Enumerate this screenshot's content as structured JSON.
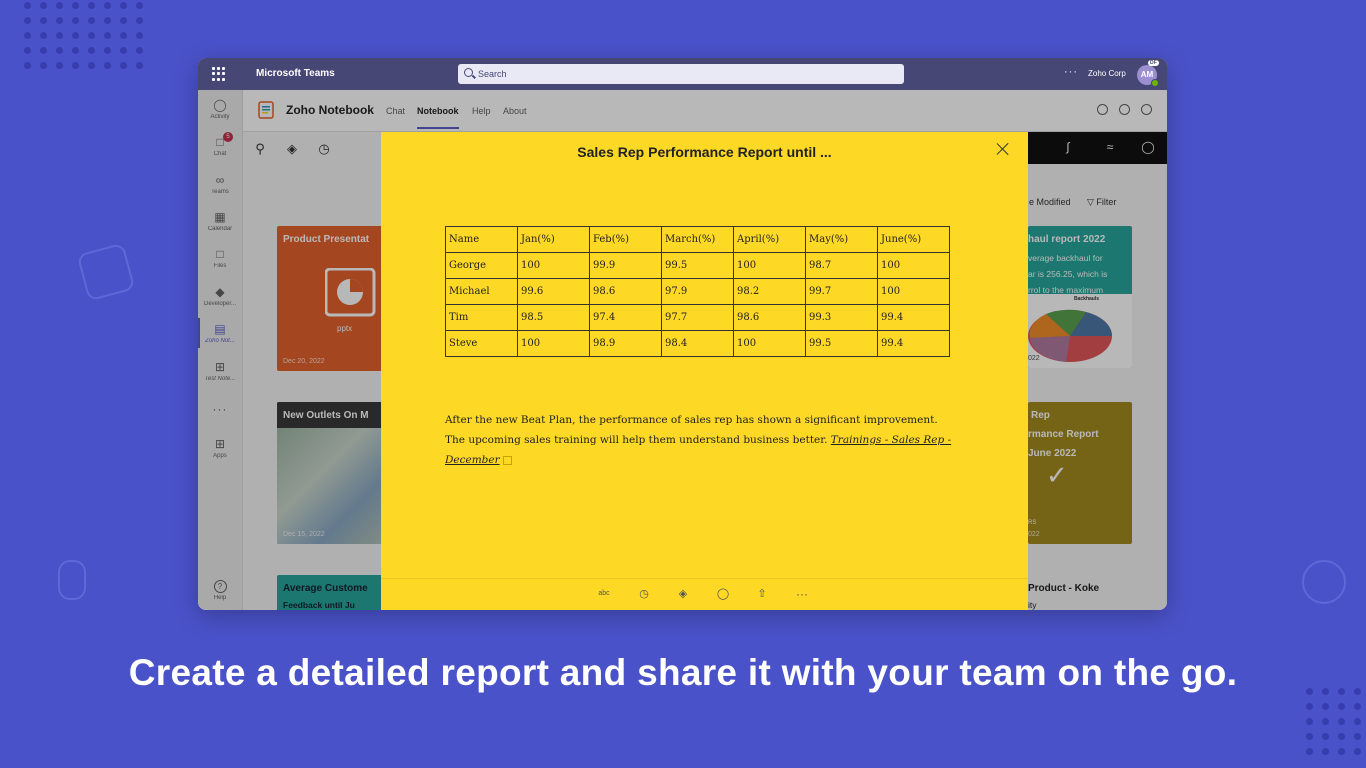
{
  "teams": {
    "app_name": "Microsoft Teams",
    "search_placeholder": "Search",
    "more": "···",
    "org": "Zoho Corp",
    "avatar_initials": "AM",
    "avatar_badge": "DF"
  },
  "rail": {
    "items": [
      {
        "label": "Activity",
        "icon": "bell-icon",
        "glyph": "🔔"
      },
      {
        "label": "Chat",
        "icon": "chat-icon",
        "glyph": "💬",
        "badge": "5"
      },
      {
        "label": "Teams",
        "icon": "teams-icon",
        "glyph": "👥"
      },
      {
        "label": "Calendar",
        "icon": "calendar-icon",
        "glyph": "📅"
      },
      {
        "label": "Files",
        "icon": "file-icon",
        "glyph": "📄"
      },
      {
        "label": "Developer...",
        "icon": "developer-icon",
        "glyph": "⟐"
      },
      {
        "label": "Zoho Not...",
        "icon": "notebook-icon",
        "glyph": "▤"
      },
      {
        "label": "Test Note...",
        "icon": "grid-icon",
        "glyph": "⊞"
      }
    ],
    "more": "···",
    "apps": "Apps",
    "help": "Help"
  },
  "app": {
    "title": "Zoho Notebook",
    "tabs": [
      "Chat",
      "Notebook",
      "Help",
      "About"
    ],
    "active_tab": "Notebook"
  },
  "notebook": {
    "sort_label": "e Modified",
    "filter_label": "Filter",
    "cards": {
      "c1_title": "Product Presentat",
      "c1_date": "Dec 20, 2022",
      "c1_badge": "pptx",
      "c2_title": "New Outlets On M",
      "c2_date": "Dec 15, 2022",
      "c3_title": "Average Custome",
      "c3_sub": "Feedback until Ju",
      "r1_title": "haul report 2022",
      "r1_line1": "verage backhaul for",
      "r1_line2": "ar is 256.25, which is",
      "r1_line3": "rrol to the maximum",
      "r1_chart_label": "Backhauls",
      "r1_date": "022",
      "r2_line1": "Rep",
      "r2_line2": "rmance Report",
      "r2_line3": "June 2022",
      "r2_date": "022",
      "r2_small": "RS",
      "r3_title": "Product - Koke",
      "r3_sub": "ity"
    }
  },
  "modal": {
    "title": "Sales Rep Performance Report until ...",
    "table": [
      [
        "Name",
        "Jan(%)",
        "Feb(%)",
        "March(%)",
        "April(%)",
        "May(%)",
        "June(%)"
      ],
      [
        "George",
        "100",
        "99.9",
        "99.5",
        "100",
        "98.7",
        "100"
      ],
      [
        "Michael",
        "99.6",
        "98.6",
        "97.9",
        "98.2",
        "99.7",
        "100"
      ],
      [
        "Tim",
        "98.5",
        "97.4",
        "97.7",
        "98.6",
        "99.3",
        "99.4"
      ],
      [
        "Steve",
        "100",
        "98.9",
        "98.4",
        "100",
        "99.5",
        "99.4"
      ]
    ],
    "note_text": "After the new Beat Plan, the performance of sales rep has shown a significant improvement. The upcoming sales training will help them understand business better. ",
    "note_link": "Trainings - Sales Rep - December"
  },
  "footer_icons": [
    "spellcheck-icon",
    "alarm-icon",
    "paint-bucket-icon",
    "share-user-icon",
    "export-icon",
    "more-icon"
  ],
  "caption": "Create a detailed report and share it with your team on the go.",
  "colors": {
    "background": "#4a52c9",
    "teams_bar": "#464775",
    "note_yellow": "#fdd824",
    "accent": "#5b5fc7",
    "card_orange": "#e4622b",
    "card_teal": "#26a69a",
    "card_olive": "#a38a1f"
  }
}
